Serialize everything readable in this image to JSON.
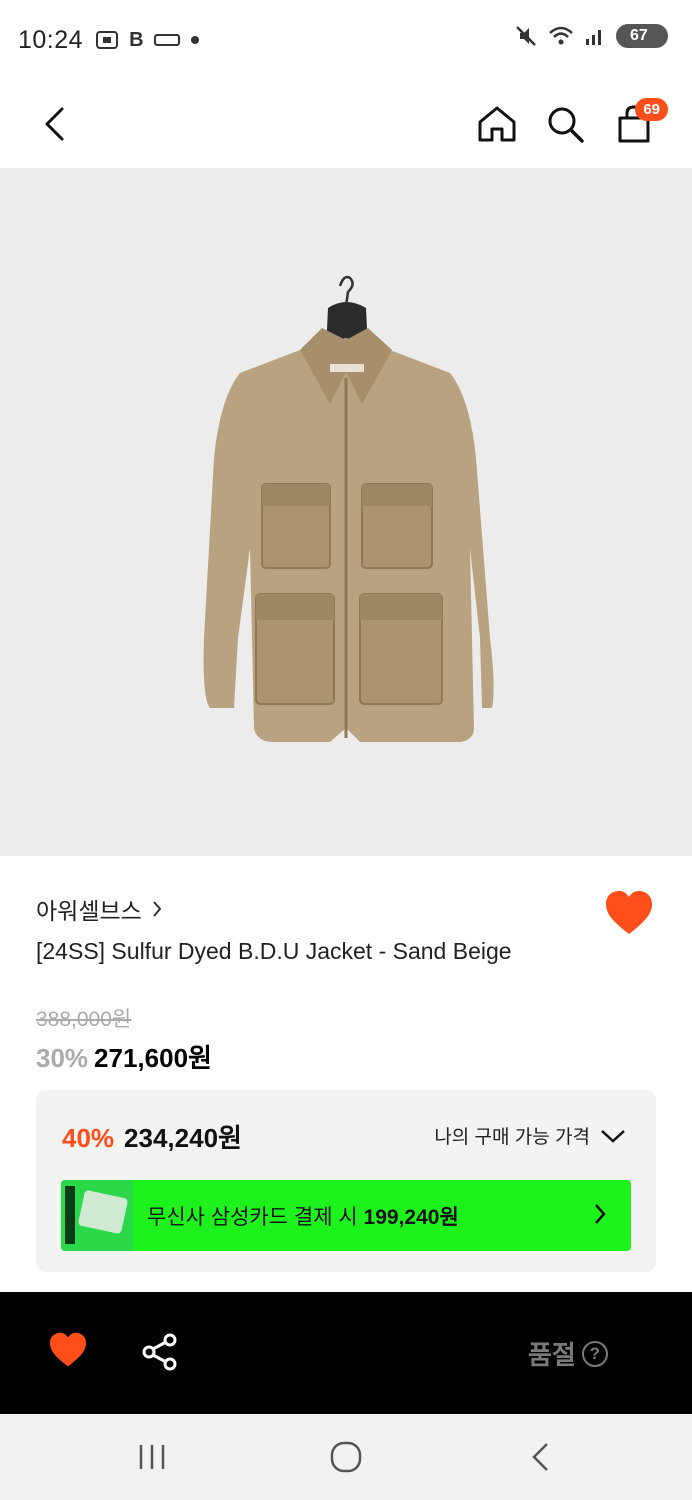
{
  "status_bar": {
    "time": "10:24",
    "left_icons": [
      "screenshot-icon",
      "b-app-icon",
      "ezf-icon",
      "dot-icon"
    ],
    "b_label": "B",
    "battery": "67"
  },
  "nav": {
    "cart_count": "69"
  },
  "product": {
    "brand": "아워셀브스",
    "title": "[24SS] Sulfur Dyed B.D.U Jacket - Sand Beige",
    "original_price": "388,000원",
    "discount_rate": "30%",
    "sale_price": "271,600원",
    "liked": true
  },
  "member_price": {
    "rate": "40%",
    "price": "234,240원",
    "toggle_label": "나의 구매 가능 가격"
  },
  "card_promo": {
    "text": "무신사 삼성카드 결제 시",
    "price": "199,240원",
    "color": "#1df21d"
  },
  "action_bar": {
    "soldout_label": "품절",
    "help_symbol": "?"
  },
  "colors": {
    "accent": "#ff4e1a",
    "image_bg": "#ececec"
  }
}
